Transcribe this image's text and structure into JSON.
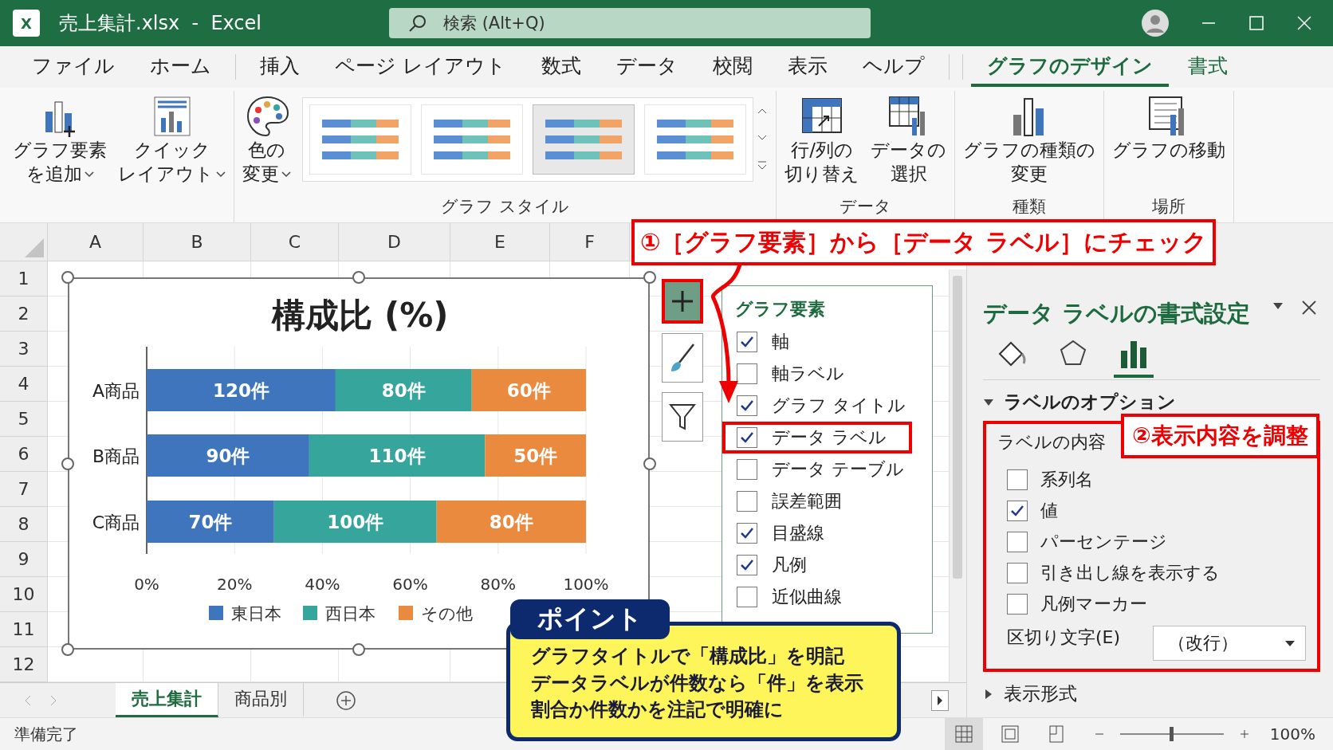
{
  "window": {
    "title": "売上集計.xlsx  -  Excel",
    "app_icon": "X"
  },
  "search": {
    "placeholder": "検索 (Alt+Q)"
  },
  "ribbon_tabs": [
    {
      "label": "ファイル",
      "selected": false,
      "kind": "normal"
    },
    {
      "label": "ホーム",
      "selected": false,
      "kind": "normal"
    },
    {
      "label": "挿入",
      "selected": false,
      "kind": "normal"
    },
    {
      "label": "ページ レイアウト",
      "selected": false,
      "kind": "normal"
    },
    {
      "label": "数式",
      "selected": false,
      "kind": "normal"
    },
    {
      "label": "データ",
      "selected": false,
      "kind": "normal"
    },
    {
      "label": "校閲",
      "selected": false,
      "kind": "normal"
    },
    {
      "label": "表示",
      "selected": false,
      "kind": "normal"
    },
    {
      "label": "ヘルプ",
      "selected": false,
      "kind": "normal"
    },
    {
      "label": "グラフのデザイン",
      "selected": true,
      "kind": "contextual"
    },
    {
      "label": "書式",
      "selected": false,
      "kind": "contextual"
    }
  ],
  "ribbon": {
    "groups": [
      {
        "items": [
          {
            "kind": "add_element",
            "lines": [
              "グラフ要素",
              "を追加"
            ],
            "dropdown": true
          },
          {
            "kind": "quick_layout",
            "lines": [
              "クイック",
              "レイアウト"
            ],
            "dropdown": true
          }
        ]
      },
      {
        "label": "グラフ スタイル",
        "items": [
          {
            "kind": "colors",
            "lines": [
              "色の",
              "変更"
            ],
            "dropdown": true
          }
        ],
        "gallery": [
          {
            "selected": false
          },
          {
            "selected": false
          },
          {
            "selected": true
          },
          {
            "selected": false
          }
        ]
      },
      {
        "label": "データ",
        "items": [
          {
            "kind": "switch_row_col",
            "lines": [
              "行/列の",
              "切り替え"
            ],
            "dropdown": false
          },
          {
            "kind": "select_data",
            "lines": [
              "データの",
              "選択"
            ],
            "dropdown": false
          }
        ]
      },
      {
        "label": "種類",
        "items": [
          {
            "kind": "change_type",
            "lines": [
              "グラフの種類の",
              "変更"
            ],
            "dropdown": false
          }
        ]
      },
      {
        "label": "場所",
        "items": [
          {
            "kind": "move_chart",
            "lines": [
              "グラフの移動"
            ],
            "dropdown": false
          }
        ]
      }
    ]
  },
  "sheet": {
    "columns": [
      "A",
      "B",
      "C",
      "D",
      "E",
      "F"
    ],
    "rows": [
      "1",
      "2",
      "3",
      "4",
      "5",
      "6",
      "7",
      "8",
      "9",
      "10",
      "11",
      "12"
    ]
  },
  "chart": {
    "chart_data": {
      "type": "bar",
      "orientation": "horizontal",
      "stacked": true,
      "title": "構成比 (%)",
      "categories": [
        "A商品",
        "B商品",
        "C商品"
      ],
      "series": [
        {
          "name": "東日本",
          "color": "#3f75bd",
          "values": [
            0.43,
            0.37,
            0.29
          ]
        },
        {
          "name": "西日本",
          "color": "#36a69c",
          "values": [
            0.31,
            0.4,
            0.37
          ]
        },
        {
          "name": "その他",
          "color": "#e98a3f",
          "values": [
            0.26,
            0.23,
            0.34
          ]
        }
      ],
      "xlim": [
        0,
        1
      ],
      "xticks": [
        {
          "value": 0,
          "label": "0%"
        },
        {
          "value": 0.2,
          "label": "20%"
        },
        {
          "value": 0.4,
          "label": "40%"
        },
        {
          "value": 0.6,
          "label": "60%"
        },
        {
          "value": 0.8,
          "label": "80%"
        },
        {
          "value": 1,
          "label": "100%"
        }
      ],
      "grid": true,
      "legend": "bottom",
      "value_labels": [
        [
          "120件",
          "90件",
          "70件"
        ],
        [
          "80件",
          "110件",
          "100件"
        ],
        [
          "60件",
          "50件",
          "80件"
        ]
      ]
    }
  },
  "chart_tools": [
    {
      "kind": "add",
      "selected": true
    },
    {
      "kind": "brush",
      "selected": false
    },
    {
      "kind": "filter",
      "selected": false
    }
  ],
  "elements_menu": {
    "title": "グラフ要素",
    "items": [
      {
        "label": "軸",
        "checked": true,
        "highlighted": false
      },
      {
        "label": "軸ラベル",
        "checked": false,
        "highlighted": false
      },
      {
        "label": "グラフ タイトル",
        "checked": true,
        "highlighted": false
      },
      {
        "label": "データ ラベル",
        "checked": true,
        "highlighted": true
      },
      {
        "label": "データ テーブル",
        "checked": false,
        "highlighted": false
      },
      {
        "label": "誤差範囲",
        "checked": false,
        "highlighted": false
      },
      {
        "label": "目盛線",
        "checked": true,
        "highlighted": false
      },
      {
        "label": "凡例",
        "checked": true,
        "highlighted": false
      },
      {
        "label": "近似曲線",
        "checked": false,
        "highlighted": false
      }
    ]
  },
  "callouts": {
    "step1": "①［グラフ要素］から［データ ラベル］にチェック",
    "step2": "②表示内容を調整"
  },
  "format_pane": {
    "title": "データ ラベルの書式設定",
    "tabs": [
      {
        "kind": "fill",
        "selected": false
      },
      {
        "kind": "effects",
        "selected": false
      },
      {
        "kind": "options",
        "selected": true
      }
    ],
    "section": {
      "label": "ラベルのオプション",
      "expanded": true
    },
    "group_label": "ラベルの内容",
    "options": [
      {
        "label": "系列名",
        "checked": false
      },
      {
        "label": "値",
        "checked": true
      },
      {
        "label": "パーセンテージ",
        "checked": false
      },
      {
        "label": "引き出し線を表示する",
        "checked": false
      },
      {
        "label": "凡例マーカー",
        "checked": false
      }
    ],
    "separator": {
      "label": "区切り文字(E)",
      "value": "（改行）"
    },
    "next_section": {
      "label": "表示形式",
      "expanded": false
    }
  },
  "sheet_tabs": [
    {
      "label": "売上集計",
      "selected": true
    },
    {
      "label": "商品別",
      "selected": false
    }
  ],
  "point": {
    "badge": "ポイント",
    "lines": [
      "グラフタイトルで「構成比」を明記",
      "データラベルが件数なら「件」を表示",
      "割合か件数かを注記で明確に"
    ]
  },
  "status_bar": {
    "status": "準備完了",
    "views": [
      {
        "kind": "normal",
        "selected": true
      },
      {
        "kind": "page_layout",
        "selected": false
      },
      {
        "kind": "page_break",
        "selected": false
      }
    ],
    "zoom": {
      "level": 0.5,
      "reading": "100%"
    }
  }
}
